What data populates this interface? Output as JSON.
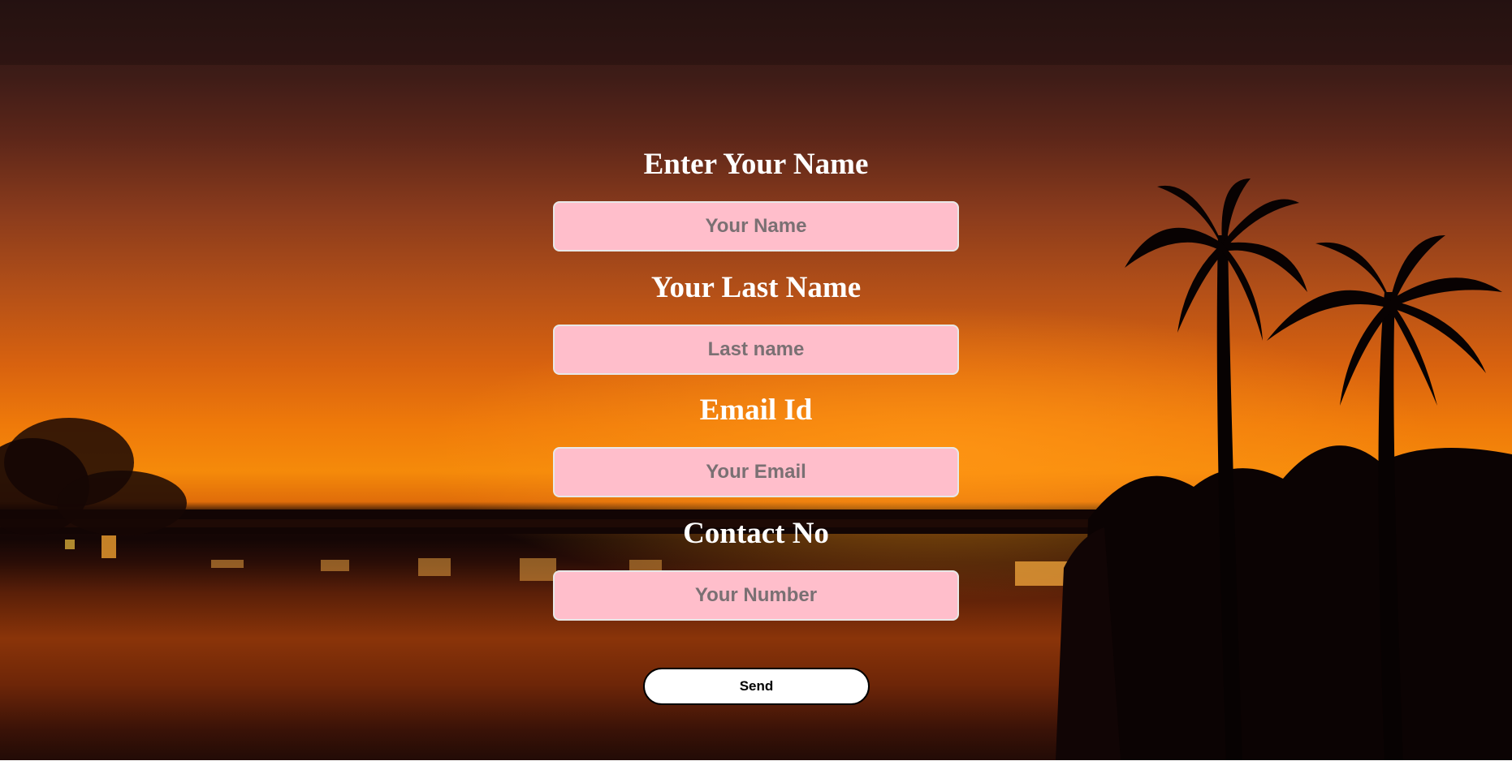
{
  "form": {
    "first_name": {
      "label": "Enter Your Name",
      "placeholder": "Your Name"
    },
    "last_name": {
      "label": "Your Last Name",
      "placeholder": "Last name"
    },
    "email": {
      "label": "Email Id",
      "placeholder": "Your Email"
    },
    "contact": {
      "label": "Contact No",
      "placeholder": "Your Number"
    },
    "submit_label": "Send"
  },
  "colors": {
    "input_background": "#ffbecb",
    "label_text": "#ffffff",
    "button_background": "#ffffff",
    "button_border": "#000000"
  }
}
